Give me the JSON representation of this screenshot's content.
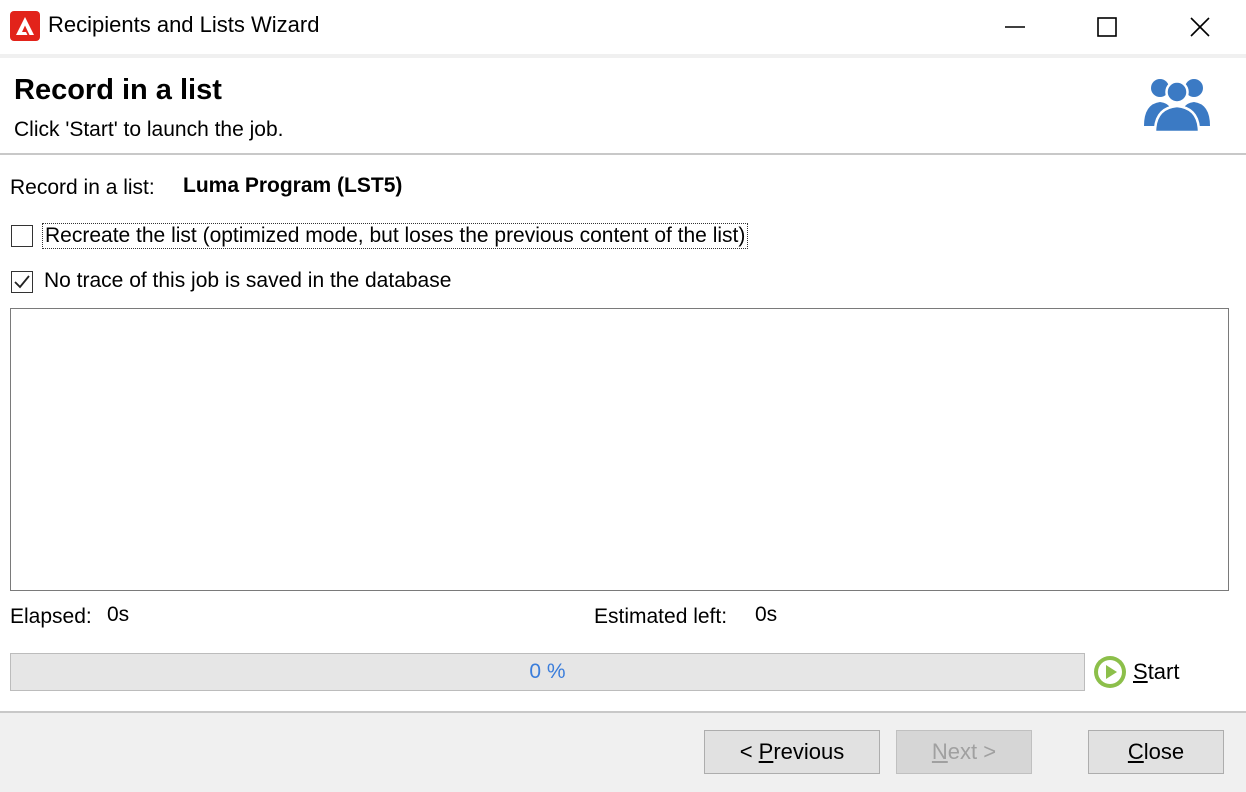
{
  "window": {
    "title": "Recipients and Lists Wizard"
  },
  "header": {
    "title": "Record in a list",
    "subtitle": "Click 'Start' to launch the job."
  },
  "form": {
    "record_label": "Record in a list:",
    "record_value": "Luma Program (LST5)",
    "recreate_label": "Recreate the list (optimized mode, but loses the previous content of the list)",
    "recreate_checked": false,
    "notrace_label": "No trace of this job is saved in the database",
    "notrace_checked": true
  },
  "stats": {
    "elapsed_label": "Elapsed:",
    "elapsed_value": "0s",
    "estimated_label": "Estimated left:",
    "estimated_value": "0s"
  },
  "progress": {
    "percent": 0,
    "text": "0 %"
  },
  "start": {
    "label_underlined": "S",
    "label_rest": "tart"
  },
  "buttons": {
    "previous_prefix": "< ",
    "previous_underlined": "P",
    "previous_rest": "revious",
    "next_underlined": "N",
    "next_rest": "ext >",
    "close_underlined": "C",
    "close_rest": "lose"
  },
  "colors": {
    "brand": "#e2231a",
    "users_icon": "#3b7ac4",
    "start_icon": "#8cbf4a",
    "progress_text": "#3a7ddb"
  },
  "icons": {
    "app": "adobe-logo-icon",
    "header": "users-icon",
    "start": "play-circle-icon"
  }
}
